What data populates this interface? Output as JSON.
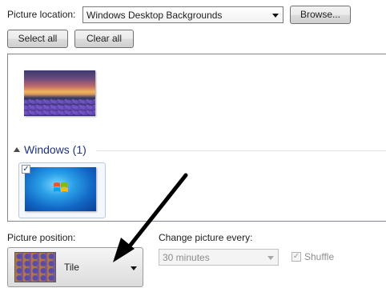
{
  "location": {
    "label": "Picture location:",
    "selected": "Windows Desktop Backgrounds",
    "browse_label": "Browse..."
  },
  "selection": {
    "select_all_label": "Select all",
    "clear_all_label": "Clear all"
  },
  "gallery": {
    "group_title": "Windows (1)",
    "checkbox_mark": "✓"
  },
  "position": {
    "label": "Picture position:",
    "selected": "Tile"
  },
  "interval": {
    "label": "Change picture every:",
    "selected": "30 minutes",
    "shuffle_label": "Shuffle",
    "shuffle_mark": "✓"
  }
}
